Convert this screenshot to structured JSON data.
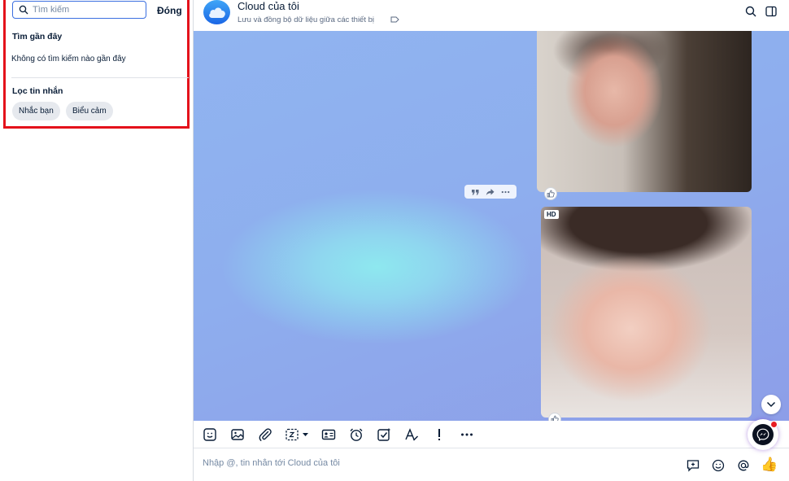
{
  "search_panel": {
    "placeholder": "Tìm kiếm",
    "close_label": "Đóng",
    "recent_title": "Tìm gần đây",
    "recent_empty": "Không có tìm kiếm nào gần đây",
    "filter_title": "Lọc tin nhắn",
    "filter_chips": [
      "Nhắc bạn",
      "Biểu cảm"
    ],
    "highlight_color": "#e4121b"
  },
  "header": {
    "title": "Cloud của tôi",
    "subtitle": "Lưu và đồng bộ dữ liệu giữa các thiết bị",
    "icons": [
      "cloud-avatar-icon",
      "tag-icon",
      "search-icon",
      "sidebar-toggle-icon"
    ]
  },
  "messages": {
    "photo_badge": "HD",
    "hover_actions": [
      "quote-icon",
      "forward-icon",
      "more-icon"
    ]
  },
  "toolbar": {
    "icons": [
      "sticker-icon",
      "image-icon",
      "attachment-icon",
      "screenshot-icon",
      "contact-card-icon",
      "reminder-icon",
      "todo-icon",
      "text-format-icon",
      "urgent-icon",
      "more-icon"
    ]
  },
  "composer": {
    "placeholder": "Nhập @, tin nhắn tới Cloud của tôi",
    "icons": [
      "quick-message-icon",
      "emoji-icon",
      "mention-icon",
      "thumbs-up-icon"
    ],
    "thumb_glyph": "👍"
  },
  "colors": {
    "accent": "#0068ff",
    "chat_background": "#8eaeee"
  }
}
